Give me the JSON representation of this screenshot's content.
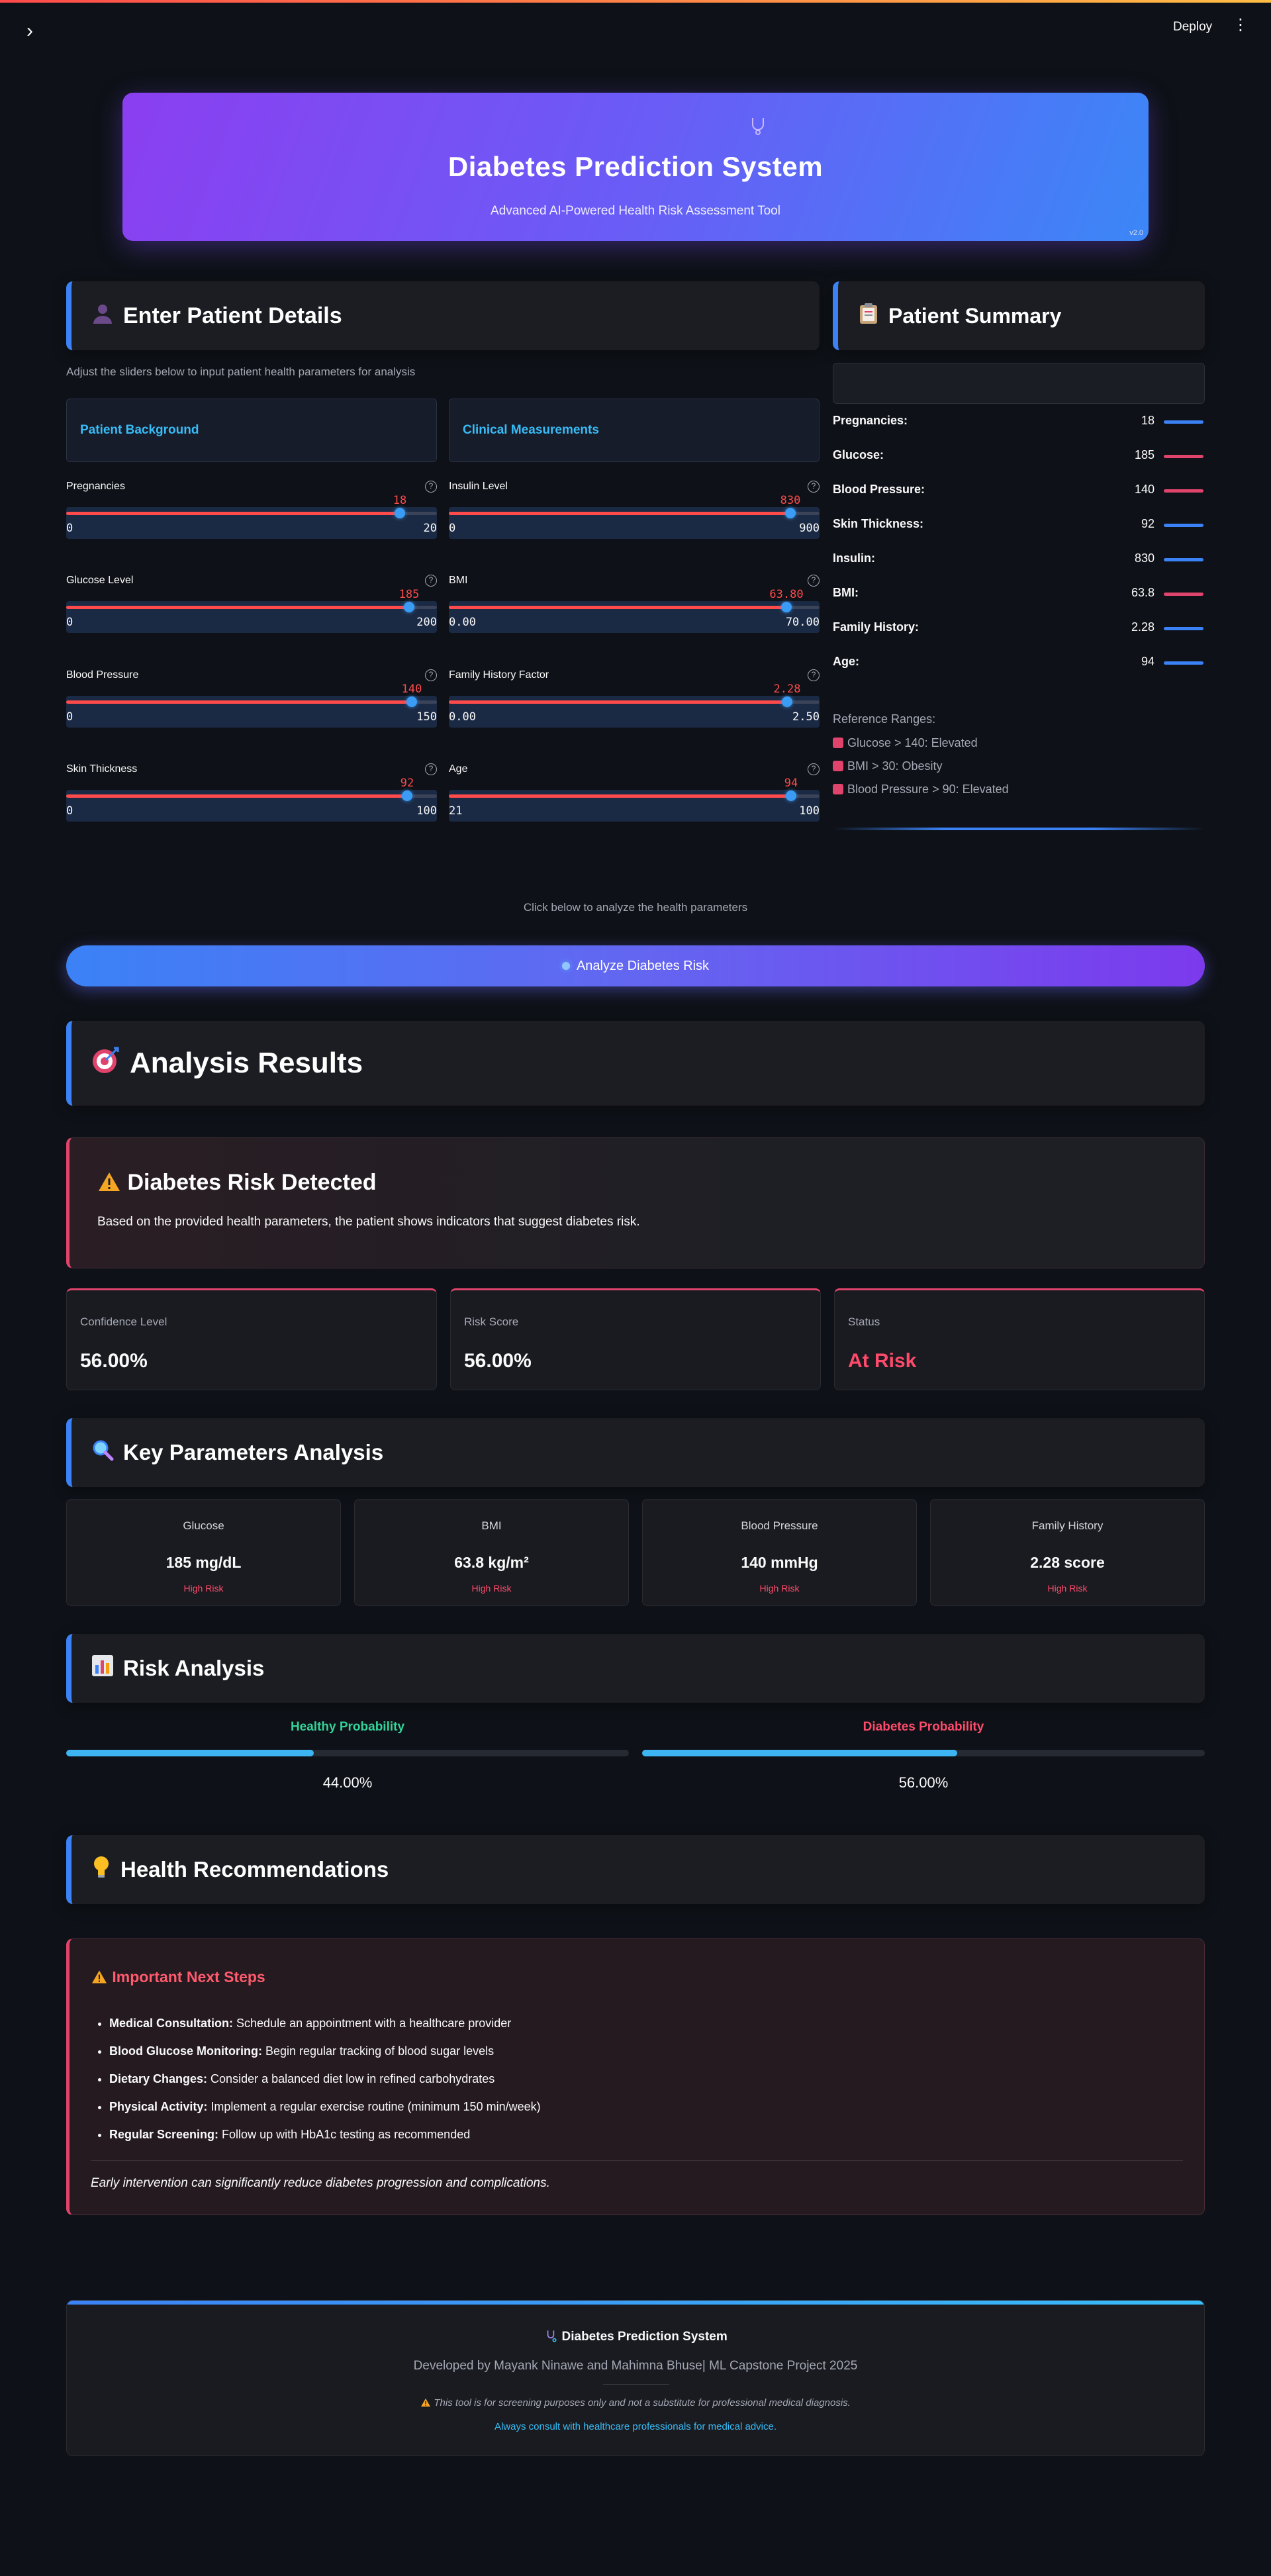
{
  "app": {
    "deploy_label": "Deploy",
    "hero_title": "Diabetes Prediction System",
    "hero_subtitle": "Advanced AI-Powered Health Risk Assessment Tool",
    "version": "v2.0"
  },
  "colors": {
    "accent_blue": "#3b82f6",
    "accent_purple": "#7c3aed",
    "danger": "#ff4b6b",
    "success": "#34d399",
    "cyan": "#38bdf8"
  },
  "input_section": {
    "title": "Enter Patient Details",
    "hint": "Adjust the sliders below to input patient health parameters for analysis",
    "tab_background": "Patient Background",
    "tab_clinical": "Clinical Measurements",
    "sliders": [
      {
        "label": "Pregnancies",
        "value": "18",
        "min": "0",
        "max": "20",
        "fraction": 0.9
      },
      {
        "label": "Insulin Level",
        "value": "830",
        "min": "0",
        "max": "900",
        "fraction": 0.922
      },
      {
        "label": "Glucose Level",
        "value": "185",
        "min": "0",
        "max": "200",
        "fraction": 0.925
      },
      {
        "label": "BMI",
        "value": "63.80",
        "min": "0.00",
        "max": "70.00",
        "fraction": 0.911
      },
      {
        "label": "Blood Pressure",
        "value": "140",
        "min": "0",
        "max": "150",
        "fraction": 0.933
      },
      {
        "label": "Family History Factor",
        "value": "2.28",
        "min": "0.00",
        "max": "2.50",
        "fraction": 0.912
      },
      {
        "label": "Skin Thickness",
        "value": "92",
        "min": "0",
        "max": "100",
        "fraction": 0.92
      },
      {
        "label": "Age",
        "value": "94",
        "min": "21",
        "max": "100",
        "fraction": 0.924
      }
    ]
  },
  "summary": {
    "title": "Patient Summary",
    "rows": [
      {
        "label": "Pregnancies:",
        "value": "18",
        "indicator": "#3b82f6"
      },
      {
        "label": "Glucose:",
        "value": "185",
        "indicator": "#e0436b"
      },
      {
        "label": "Blood Pressure:",
        "value": "140",
        "indicator": "#e0436b"
      },
      {
        "label": "Skin Thickness:",
        "value": "92",
        "indicator": "#3b82f6"
      },
      {
        "label": "Insulin:",
        "value": "830",
        "indicator": "#3b82f6"
      },
      {
        "label": "BMI:",
        "value": "63.8",
        "indicator": "#e0436b"
      },
      {
        "label": "Family History:",
        "value": "2.28",
        "indicator": "#3b82f6"
      },
      {
        "label": "Age:",
        "value": "94",
        "indicator": "#3b82f6"
      }
    ],
    "ref_title": "Reference Ranges:",
    "refs": [
      "Glucose > 140: Elevated",
      "BMI > 30: Obesity",
      "Blood Pressure > 90: Elevated"
    ]
  },
  "analyze": {
    "note": "Click below to analyze the health parameters",
    "button_label": "Analyze Diabetes Risk"
  },
  "results": {
    "title": "Analysis Results",
    "alert_title": "Diabetes Risk Detected",
    "alert_text": "Based on the provided health parameters, the patient shows indicators that suggest diabetes risk.",
    "metrics": [
      {
        "label": "Confidence Level",
        "value": "56.00%"
      },
      {
        "label": "Risk Score",
        "value": "56.00%"
      },
      {
        "label": "Status",
        "value": "At Risk"
      }
    ]
  },
  "key_params": {
    "title": "Key Parameters Analysis",
    "items": [
      {
        "label": "Glucose",
        "value": "185 mg/dL",
        "risk": "High Risk"
      },
      {
        "label": "BMI",
        "value": "63.8 kg/m²",
        "risk": "High Risk"
      },
      {
        "label": "Blood Pressure",
        "value": "140 mmHg",
        "risk": "High Risk"
      },
      {
        "label": "Family History",
        "value": "2.28 score",
        "risk": "High Risk"
      }
    ]
  },
  "risk_analysis": {
    "title": "Risk Analysis",
    "healthy_label": "Healthy Probability",
    "healthy_value": "44.00%",
    "healthy_fraction": 0.44,
    "diabetes_label": "Diabetes Probability",
    "diabetes_value": "56.00%",
    "diabetes_fraction": 0.56
  },
  "recommendations": {
    "title": "Health Recommendations",
    "card_title": "Important Next Steps",
    "items": [
      {
        "bold": "Medical Consultation:",
        "text": " Schedule an appointment with a healthcare provider"
      },
      {
        "bold": "Blood Glucose Monitoring:",
        "text": " Begin regular tracking of blood sugar levels"
      },
      {
        "bold": "Dietary Changes:",
        "text": " Consider a balanced diet low in refined carbohydrates"
      },
      {
        "bold": "Physical Activity:",
        "text": " Implement a regular exercise routine (minimum 150 min/week)"
      },
      {
        "bold": "Regular Screening:",
        "text": " Follow up with HbA1c testing as recommended"
      }
    ],
    "note": "Early intervention can significantly reduce diabetes progression and complications."
  },
  "footer": {
    "title": "Diabetes Prediction System",
    "credits": "Developed by Mayank Ninawe and Mahimna Bhuse| ML Capstone Project 2025",
    "disclaimer": "This tool is for screening purposes only and not a substitute for professional medical diagnosis.",
    "advice": "Always consult with healthcare professionals for medical advice."
  }
}
